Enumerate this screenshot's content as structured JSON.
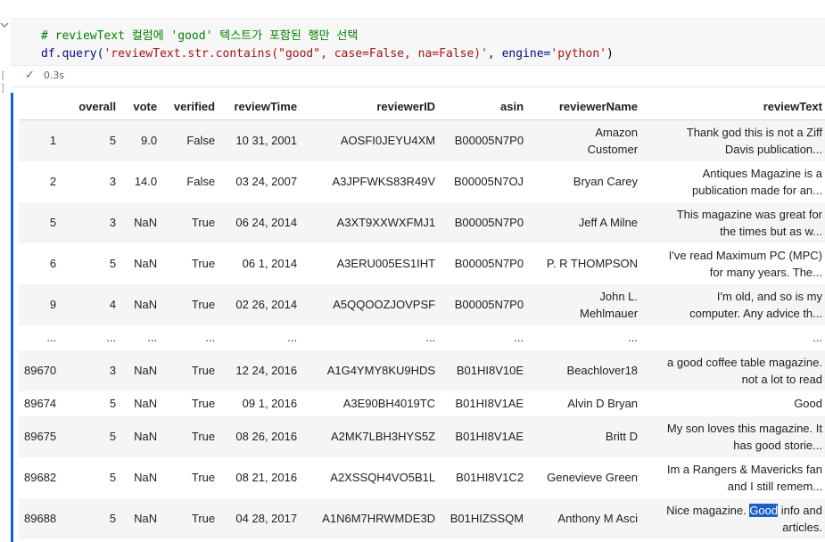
{
  "cell": {
    "code_line_1": "# reviewText 컬럼에 'good' 텍스트가 포함된 행만 선택",
    "code_line_2": {
      "p1": "df.query(",
      "p2": "'reviewText.str.contains(\"good\", case=False, na=False)'",
      "p3": ", engine=",
      "p4": "'python'",
      "p5": ")"
    },
    "exec_time": "0.3s",
    "status_icon": "check-icon",
    "chevron_icon": "chevron-down-icon",
    "bracket_glyph": "[ ]"
  },
  "table": {
    "columns": [
      "",
      "overall",
      "vote",
      "verified",
      "reviewTime",
      "reviewerID",
      "asin",
      "reviewerName",
      "reviewText"
    ],
    "rows": [
      {
        "idx": "1",
        "overall": "5",
        "vote": "9.0",
        "verified": "False",
        "reviewTime": "10 31, 2001",
        "reviewerID": "AOSFI0JEYU4XM",
        "asin": "B00005N7P0",
        "reviewerName_a": "Amazon",
        "reviewerName_b": "Customer",
        "text_a": "Thank god this is not a Ziff",
        "text_b": "Davis publication...",
        "size": "tall"
      },
      {
        "idx": "2",
        "overall": "3",
        "vote": "14.0",
        "verified": "False",
        "reviewTime": "03 24, 2007",
        "reviewerID": "A3JPFWKS83R49V",
        "asin": "B00005N7OJ",
        "reviewerName_a": "Bryan Carey",
        "reviewerName_b": "",
        "text_a": "Antiques Magazine is a",
        "text_b": "publication made for an...",
        "size": "tall"
      },
      {
        "idx": "5",
        "overall": "3",
        "vote": "NaN",
        "verified": "True",
        "reviewTime": "06 24, 2014",
        "reviewerID": "A3XT9XXWXFMJ1",
        "asin": "B00005N7P0",
        "reviewerName_a": "Jeff A Milne",
        "reviewerName_b": "",
        "text_a": "This magazine was great for",
        "text_b": "the times but as w...",
        "size": "tall"
      },
      {
        "idx": "6",
        "overall": "5",
        "vote": "NaN",
        "verified": "True",
        "reviewTime": "06 1, 2014",
        "reviewerID": "A3ERU005ES1IHT",
        "asin": "B00005N7P0",
        "reviewerName_a": "P. R THOMPSON",
        "reviewerName_b": "",
        "text_a": "I've read Maximum PC (MPC)",
        "text_b": "for many years. The...",
        "size": "tall"
      },
      {
        "idx": "9",
        "overall": "4",
        "vote": "NaN",
        "verified": "True",
        "reviewTime": "02 26, 2014",
        "reviewerID": "A5QQOOZJOVPSF",
        "asin": "B00005N7P0",
        "reviewerName_a": "John L.",
        "reviewerName_b": "Mehlmauer",
        "text_a": "I'm old, and so is my",
        "text_b": "computer. Any advice th...",
        "size": "tall"
      },
      {
        "idx": "...",
        "overall": "...",
        "vote": "...",
        "verified": "...",
        "reviewTime": "...",
        "reviewerID": "...",
        "asin": "...",
        "reviewerName_a": "...",
        "reviewerName_b": "",
        "text_a": "...",
        "text_b": "",
        "size": "short"
      },
      {
        "idx": "89670",
        "overall": "3",
        "vote": "NaN",
        "verified": "True",
        "reviewTime": "12 24, 2016",
        "reviewerID": "A1G4YMY8KU9HDS",
        "asin": "B01HI8V10E",
        "reviewerName_a": "Beachlover18",
        "reviewerName_b": "",
        "text_a": "a good coffee table magazine.",
        "text_b": "not a lot to read",
        "size": "tall"
      },
      {
        "idx": "89674",
        "overall": "5",
        "vote": "NaN",
        "verified": "True",
        "reviewTime": "09 1, 2016",
        "reviewerID": "A3E90BH4019TC",
        "asin": "B01HI8V1AE",
        "reviewerName_a": "Alvin D Bryan",
        "reviewerName_b": "",
        "text_a": "Good",
        "text_b": "",
        "size": "short"
      },
      {
        "idx": "89675",
        "overall": "5",
        "vote": "NaN",
        "verified": "True",
        "reviewTime": "08 26, 2016",
        "reviewerID": "A2MK7LBH3HYS5Z",
        "asin": "B01HI8V1AE",
        "reviewerName_a": "Britt D",
        "reviewerName_b": "",
        "text_a": "My son loves this magazine. It",
        "text_b": "has good storie...",
        "size": "tall"
      },
      {
        "idx": "89682",
        "overall": "5",
        "vote": "NaN",
        "verified": "True",
        "reviewTime": "08 21, 2016",
        "reviewerID": "A2XSSQH4VO5B1L",
        "asin": "B01HI8V1C2",
        "reviewerName_a": "Genevieve Green",
        "reviewerName_b": "",
        "text_a": "Im a Rangers & Mavericks fan",
        "text_b": "and I still remem...",
        "size": "tall"
      },
      {
        "idx": "89688",
        "overall": "5",
        "vote": "NaN",
        "verified": "True",
        "reviewTime": "04 28, 2017",
        "reviewerID": "A1N6M7HRWMDE3D",
        "asin": "B01HIZSSQM",
        "reviewerName_a": "Anthony M Asci",
        "reviewerName_b": "",
        "text_a_pre": "Nice magazine. ",
        "text_a_hl": "Good",
        "text_a_post": " info and",
        "text_b": "articles.",
        "size": "tall"
      }
    ]
  },
  "colors": {
    "output_accent": "#1565c0",
    "highlight": "#1d60c8",
    "check": "#388a34"
  }
}
